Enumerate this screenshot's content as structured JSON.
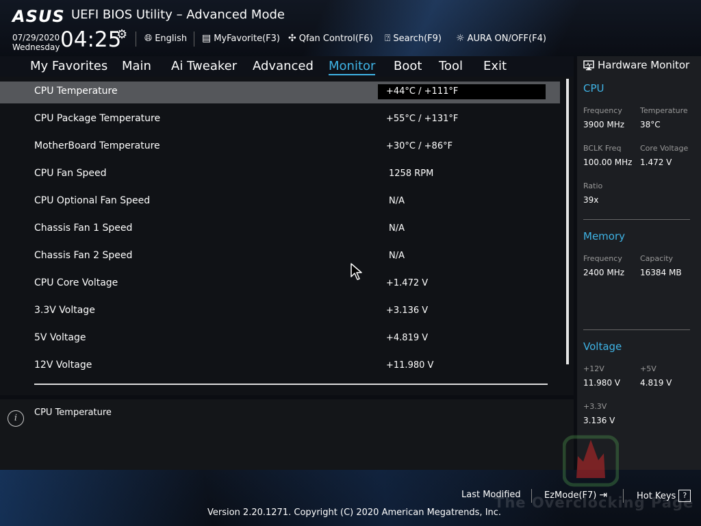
{
  "header": {
    "brand": "ASUS",
    "title": "UEFI BIOS Utility – Advanced Mode",
    "date": "07/29/2020",
    "weekday": "Wednesday",
    "time": "04:25",
    "language": "English",
    "myfavorite": "MyFavorite(F3)",
    "qfan": "Qfan Control(F6)",
    "search": "Search(F9)",
    "aura": "AURA ON/OFF(F4)"
  },
  "nav": {
    "items": [
      "My Favorites",
      "Main",
      "Ai Tweaker",
      "Advanced",
      "Monitor",
      "Boot",
      "Tool",
      "Exit"
    ],
    "active": "Monitor"
  },
  "monitor_rows": [
    {
      "label": "CPU Temperature",
      "value": "+44°C / +111°F"
    },
    {
      "label": "CPU Package Temperature",
      "value": "+55°C / +131°F"
    },
    {
      "label": "MotherBoard Temperature",
      "value": "+30°C / +86°F"
    },
    {
      "label": "CPU Fan Speed",
      "value": "1258 RPM"
    },
    {
      "label": "CPU Optional Fan Speed",
      "value": "N/A"
    },
    {
      "label": "Chassis Fan 1 Speed",
      "value": "N/A"
    },
    {
      "label": "Chassis Fan 2 Speed",
      "value": "N/A"
    },
    {
      "label": "CPU Core Voltage",
      "value": "+1.472 V"
    },
    {
      "label": "3.3V Voltage",
      "value": "+3.136 V"
    },
    {
      "label": "5V Voltage",
      "value": "+4.819 V"
    },
    {
      "label": "12V Voltage",
      "value": "+11.980 V"
    }
  ],
  "info": {
    "text": "CPU Temperature"
  },
  "hw_monitor": {
    "title": "Hardware Monitor",
    "cpu": {
      "heading": "CPU",
      "frequency_label": "Frequency",
      "frequency": "3900 MHz",
      "temperature_label": "Temperature",
      "temperature": "38°C",
      "bclk_label": "BCLK Freq",
      "bclk": "100.00 MHz",
      "core_voltage_label": "Core Voltage",
      "core_voltage": "1.472 V",
      "ratio_label": "Ratio",
      "ratio": "39x"
    },
    "memory": {
      "heading": "Memory",
      "frequency_label": "Frequency",
      "frequency": "2400 MHz",
      "capacity_label": "Capacity",
      "capacity": "16384 MB"
    },
    "voltage": {
      "heading": "Voltage",
      "v12_label": "+12V",
      "v12": "11.980 V",
      "v5_label": "+5V",
      "v5": "4.819 V",
      "v33_label": "+3.3V",
      "v33": "3.136 V"
    }
  },
  "footer": {
    "last_modified": "Last Modified",
    "ezmode": "EzMode(F7)",
    "hotkeys": "Hot Keys",
    "hotkeys_key": "?",
    "version": "Version 2.20.1271. Copyright (C) 2020 American Megatrends, Inc.",
    "watermark": "The Overclocking Page"
  },
  "colors": {
    "accent": "#3fb4e6",
    "selected_row": "#55575b",
    "panel": "#1c1e22"
  }
}
